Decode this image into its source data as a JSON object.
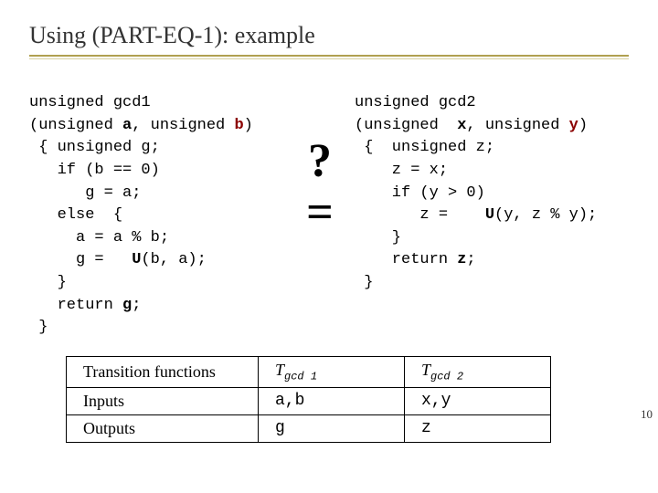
{
  "title": "Using (PART-EQ-1): example",
  "symbols": {
    "question": "?",
    "equals": "="
  },
  "code_left": {
    "l1": "unsigned gcd1",
    "l2a": "(unsigned ",
    "l2b": "a",
    "l2c": ", unsigned ",
    "l2d": "b",
    "l2e": ")",
    "l3": " { unsigned g;",
    "l4": "   if (b == 0)",
    "l5": "      g = a;",
    "l6": "   else  {",
    "l7": "     a = a % b;",
    "l8a": "     g =   ",
    "l8b": "U",
    "l8c": "(b, a);",
    "l9": "   }",
    "l10a": "   return ",
    "l10b": "g",
    "l10c": ";",
    "l11": " }"
  },
  "code_right": {
    "l1": "unsigned gcd2",
    "l2a": "(unsigned  ",
    "l2b": "x",
    "l2c": ", unsigned ",
    "l2d": "y",
    "l2e": ")",
    "l3": " {  unsigned z;",
    "l4": "    z = x;",
    "l5": "    if (y > 0)",
    "l6a": "       z =    ",
    "l6b": "U",
    "l6c": "(y, z % y);",
    "l7": "    }",
    "l8a": "    return ",
    "l8b": "z",
    "l8c": ";",
    "l9": " }"
  },
  "table": {
    "rows": [
      {
        "label": "Transition functions",
        "c1_pre": "T",
        "c1_sub": "gcd 1",
        "c2_pre": "T",
        "c2_sub": "gcd 2"
      },
      {
        "label": "Inputs",
        "c1": "a,b",
        "c2": "x,y"
      },
      {
        "label": "Outputs",
        "c1": "g",
        "c2": "z"
      }
    ]
  },
  "page_number": "10"
}
